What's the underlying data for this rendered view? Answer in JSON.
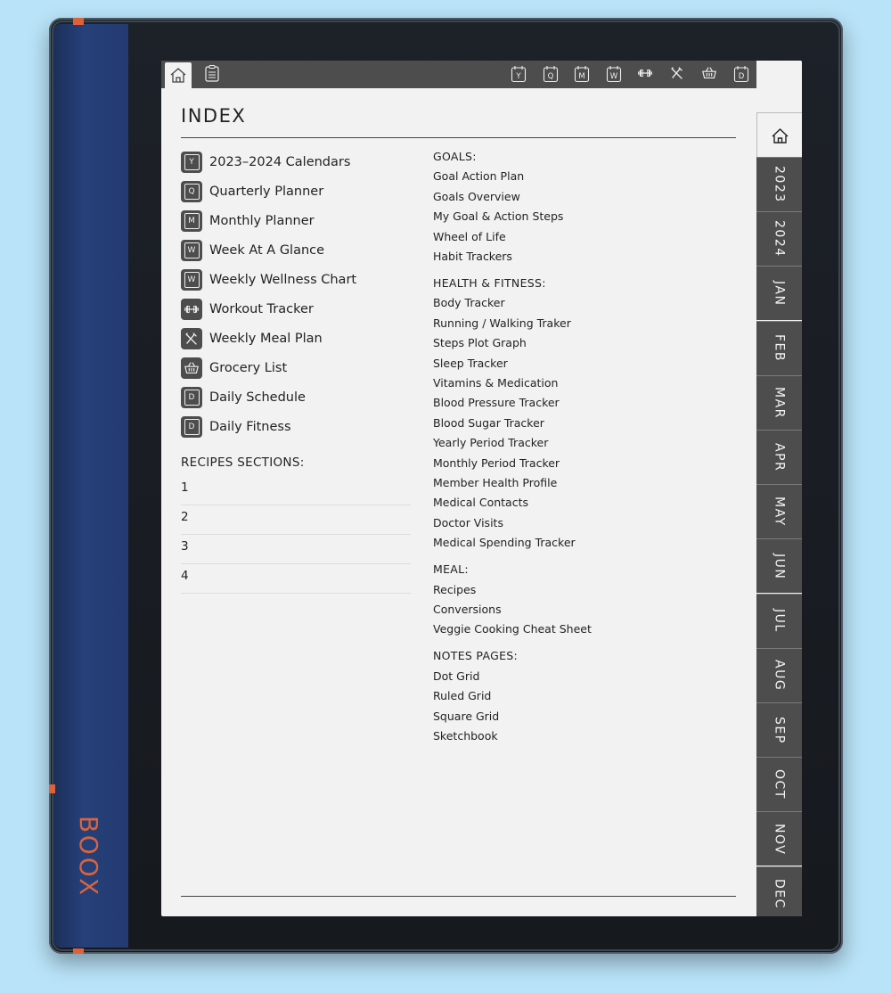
{
  "brand": "BOOX",
  "index_title": "INDEX",
  "topbar_icons": [
    "Y",
    "Q",
    "M",
    "W",
    "dumbbell",
    "fork-knife",
    "basket",
    "D"
  ],
  "left_items": [
    {
      "icon": "Y",
      "label": "2023–2024 Calendars"
    },
    {
      "icon": "Q",
      "label": "Quarterly Planner"
    },
    {
      "icon": "M",
      "label": "Monthly Planner"
    },
    {
      "icon": "W",
      "label": "Week At A Glance"
    },
    {
      "icon": "W",
      "label": "Weekly Wellness Chart"
    },
    {
      "icon": "dumbbell",
      "label": "Workout Tracker"
    },
    {
      "icon": "fork-knife",
      "label": "Weekly Meal Plan"
    },
    {
      "icon": "basket",
      "label": "Grocery List"
    },
    {
      "icon": "D",
      "label": "Daily Schedule"
    },
    {
      "icon": "D",
      "label": "Daily Fitness"
    }
  ],
  "recipes": {
    "heading": "RECIPES SECTIONS:",
    "rows": [
      "1",
      "2",
      "3",
      "4"
    ]
  },
  "sections": [
    {
      "heading": "GOALS:",
      "items": [
        "Goal Action Plan",
        "Goals Overview",
        "My Goal & Action Steps",
        "Wheel of Life",
        "Habit Trackers"
      ]
    },
    {
      "heading": "HEALTH & FITNESS:",
      "items": [
        "Body Tracker",
        "Running / Walking Traker",
        "Steps Plot Graph",
        "Sleep Tracker",
        "Vitamins & Medication",
        "Blood Pressure Tracker",
        "Blood Sugar Tracker",
        "Yearly Period Tracker",
        "Monthly Period Tracker",
        "Member Health Profile",
        "Medical Contacts",
        "Doctor Visits",
        "Medical Spending Tracker"
      ]
    },
    {
      "heading": "MEAL:",
      "items": [
        "Recipes",
        "Conversions",
        "Veggie Cooking Cheat Sheet"
      ]
    },
    {
      "heading": "NOTES PAGES:",
      "items": [
        "Dot Grid",
        "Ruled Grid",
        "Square Grid",
        "Sketchbook"
      ]
    }
  ],
  "side_tabs": [
    "2023",
    "2024",
    "JAN",
    "FEB",
    "MAR",
    "APR",
    "MAY",
    "JUN",
    "JUL",
    "AUG",
    "SEP",
    "OCT",
    "NOV",
    "DEC"
  ],
  "colors": {
    "background": "#b9e3f8",
    "tab_dark": "#4d4d4d",
    "paper": "#f2f2f2",
    "brand_orange": "#d8643c"
  }
}
